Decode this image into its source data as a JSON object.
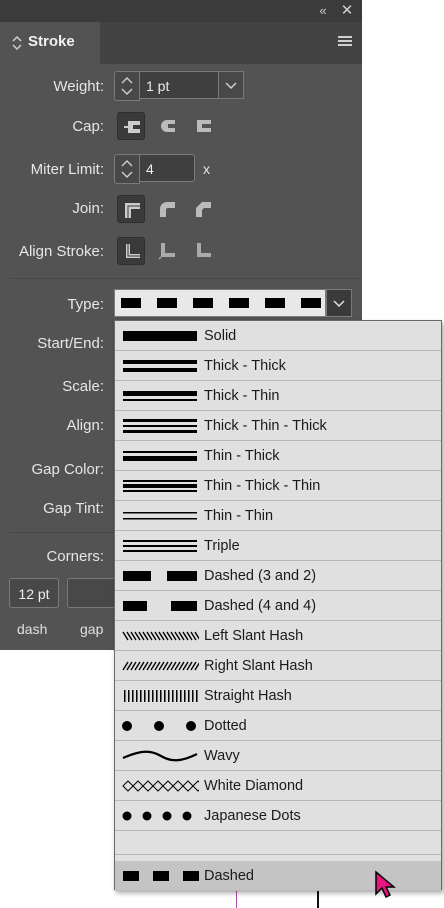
{
  "panel": {
    "title": "Stroke",
    "collapse_icon": "double-chevron-left-icon",
    "close_icon": "close-icon",
    "menu_icon": "hamburger-menu-icon"
  },
  "weight": {
    "label": "Weight:",
    "value": "1 pt"
  },
  "cap": {
    "label": "Cap:"
  },
  "miter": {
    "label": "Miter Limit:",
    "value": "4",
    "suffix": "x"
  },
  "join": {
    "label": "Join:"
  },
  "align_stroke": {
    "label": "Align Stroke:"
  },
  "type": {
    "label": "Type:"
  },
  "start_end": {
    "label": "Start/End:"
  },
  "scale": {
    "label": "Scale:"
  },
  "align": {
    "label": "Align:"
  },
  "gap_color": {
    "label": "Gap Color:"
  },
  "gap_tint": {
    "label": "Gap Tint:"
  },
  "corners": {
    "label": "Corners:"
  },
  "dash_row": {
    "dash_value": "12 pt",
    "dash_label": "dash",
    "gap_label": "gap"
  },
  "dropdown": {
    "items": [
      {
        "label": "Solid",
        "style": "solid"
      },
      {
        "label": "Thick - Thick",
        "style": "thick-thick"
      },
      {
        "label": "Thick - Thin",
        "style": "thick-thin"
      },
      {
        "label": "Thick - Thin - Thick",
        "style": "thick-thin-thick"
      },
      {
        "label": "Thin - Thick",
        "style": "thin-thick"
      },
      {
        "label": "Thin - Thick - Thin",
        "style": "thin-thick-thin"
      },
      {
        "label": "Thin - Thin",
        "style": "thin-thin"
      },
      {
        "label": "Triple",
        "style": "triple"
      },
      {
        "label": "Dashed (3 and 2)",
        "style": "dashed-3-2"
      },
      {
        "label": "Dashed (4 and 4)",
        "style": "dashed-4-4"
      },
      {
        "label": "Left Slant Hash",
        "style": "left-slant"
      },
      {
        "label": "Right Slant Hash",
        "style": "right-slant"
      },
      {
        "label": "Straight Hash",
        "style": "straight-hash"
      },
      {
        "label": "Dotted",
        "style": "dotted"
      },
      {
        "label": "Wavy",
        "style": "wavy"
      },
      {
        "label": "White Diamond",
        "style": "white-diamond"
      },
      {
        "label": "Japanese Dots",
        "style": "japanese-dots"
      },
      {
        "label": "",
        "style": "blank"
      },
      {
        "label": "",
        "style": "blank"
      },
      {
        "label": "Dashed",
        "style": "dashed"
      }
    ],
    "selected_index": 19
  }
}
